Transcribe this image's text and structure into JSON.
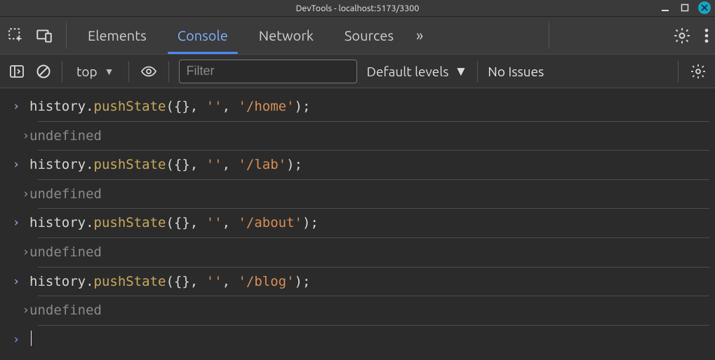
{
  "window": {
    "title": "DevTools - localhost:5173/3300"
  },
  "tabs": {
    "items": [
      "Elements",
      "Console",
      "Network",
      "Sources"
    ],
    "active": "Console",
    "overflow_glyph": "»"
  },
  "console_toolbar": {
    "context_label": "top",
    "filter_placeholder": "Filter",
    "levels_label": "Default levels",
    "issues_label": "No Issues"
  },
  "syntax": {
    "obj": "history",
    "fn": "pushState",
    "open": "({}, ",
    "empty": "''",
    "comma": ", ",
    "close": ");",
    "undef": "undefined"
  },
  "log": [
    {
      "type": "input",
      "path": "'/home'"
    },
    {
      "type": "return"
    },
    {
      "type": "input",
      "path": "'/lab'"
    },
    {
      "type": "return"
    },
    {
      "type": "input",
      "path": "'/about'"
    },
    {
      "type": "return"
    },
    {
      "type": "input",
      "path": "'/blog'"
    },
    {
      "type": "return"
    }
  ]
}
